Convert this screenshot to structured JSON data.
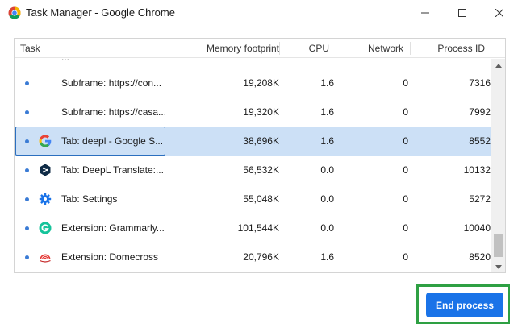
{
  "window": {
    "title": "Task Manager - Google Chrome"
  },
  "table": {
    "columns": {
      "task": "Task",
      "memory": "Memory footprint",
      "cpu": "CPU",
      "network": "Network",
      "pid": "Process ID"
    },
    "partial_row_text": "...",
    "rows": [
      {
        "icon": "dot-only",
        "task": "Subframe: https://con...",
        "memory": "19,208K",
        "cpu": "1.6",
        "network": "0",
        "pid": "7316",
        "selected": false
      },
      {
        "icon": "dot-only",
        "task": "Subframe: https://casa...",
        "memory": "19,320K",
        "cpu": "1.6",
        "network": "0",
        "pid": "7992",
        "selected": false
      },
      {
        "icon": "google-g-icon",
        "task": "Tab: deepl - Google S...",
        "memory": "38,696K",
        "cpu": "1.6",
        "network": "0",
        "pid": "8552",
        "selected": true
      },
      {
        "icon": "deepl-icon",
        "task": "Tab: DeepL Translate:...",
        "memory": "56,532K",
        "cpu": "0.0",
        "network": "0",
        "pid": "10132",
        "selected": false
      },
      {
        "icon": "settings-gear-icon",
        "task": "Tab: Settings",
        "memory": "55,048K",
        "cpu": "0.0",
        "network": "0",
        "pid": "5272",
        "selected": false
      },
      {
        "icon": "grammarly-icon",
        "task": "Extension: Grammarly...",
        "memory": "101,544K",
        "cpu": "0.0",
        "network": "0",
        "pid": "10040",
        "selected": false
      },
      {
        "icon": "domecross-icon",
        "task": "Extension: Domecross",
        "memory": "20,796K",
        "cpu": "1.6",
        "network": "0",
        "pid": "8520",
        "selected": false
      }
    ]
  },
  "actions": {
    "end_process_label": "End process"
  },
  "colors": {
    "accent": "#1a73e8",
    "selection": "#cce0f6",
    "highlight": "#2ea043"
  }
}
